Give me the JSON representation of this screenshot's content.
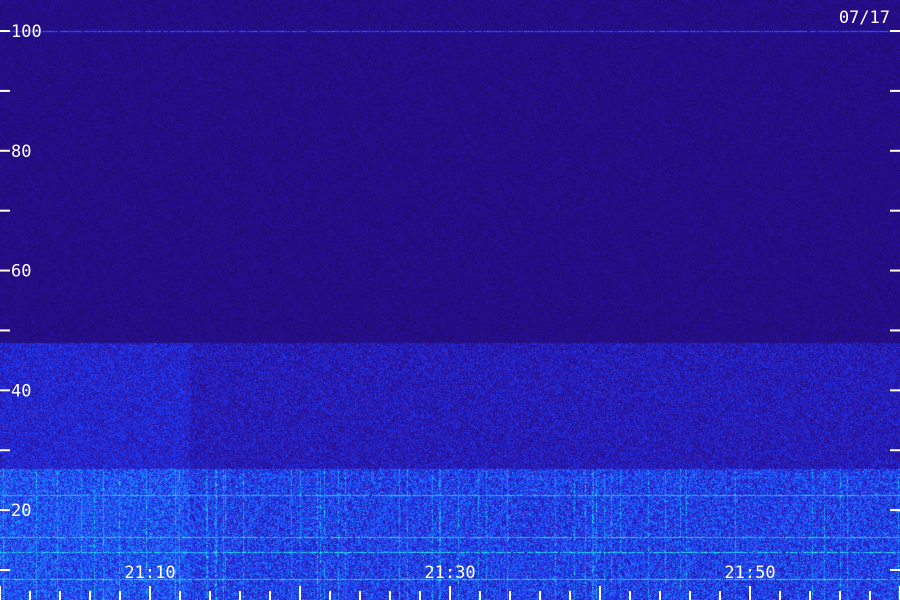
{
  "date_label": "07/17",
  "chart_data": {
    "type": "heatmap",
    "title": "",
    "xlabel": "",
    "ylabel": "",
    "x_tick_labels": [
      "21:10",
      "21:30",
      "21:50"
    ],
    "y_tick_labels": [
      "20",
      "40",
      "60",
      "80",
      "100"
    ],
    "ylim": [
      0,
      102
    ],
    "colormap": [
      "#1a0a55",
      "#2a10a0",
      "#2040ff",
      "#20a0ff",
      "#30ffd0"
    ],
    "features": [
      {
        "kind": "band",
        "y_range": [
          0,
          27
        ],
        "intensity": "high"
      },
      {
        "kind": "band",
        "y_range": [
          27,
          48
        ],
        "intensity": "medium"
      },
      {
        "kind": "band",
        "y_range": [
          48,
          102
        ],
        "intensity": "low"
      },
      {
        "kind": "line",
        "y": 8.5,
        "intensity": "high"
      },
      {
        "kind": "line",
        "y": 13,
        "intensity": "high"
      },
      {
        "kind": "line",
        "y": 15.5,
        "intensity": "high"
      },
      {
        "kind": "line",
        "y": 22.5,
        "intensity": "high"
      },
      {
        "kind": "line",
        "y": 25.5,
        "intensity": "medium"
      },
      {
        "kind": "line",
        "y": 100,
        "intensity": "medium"
      }
    ]
  }
}
